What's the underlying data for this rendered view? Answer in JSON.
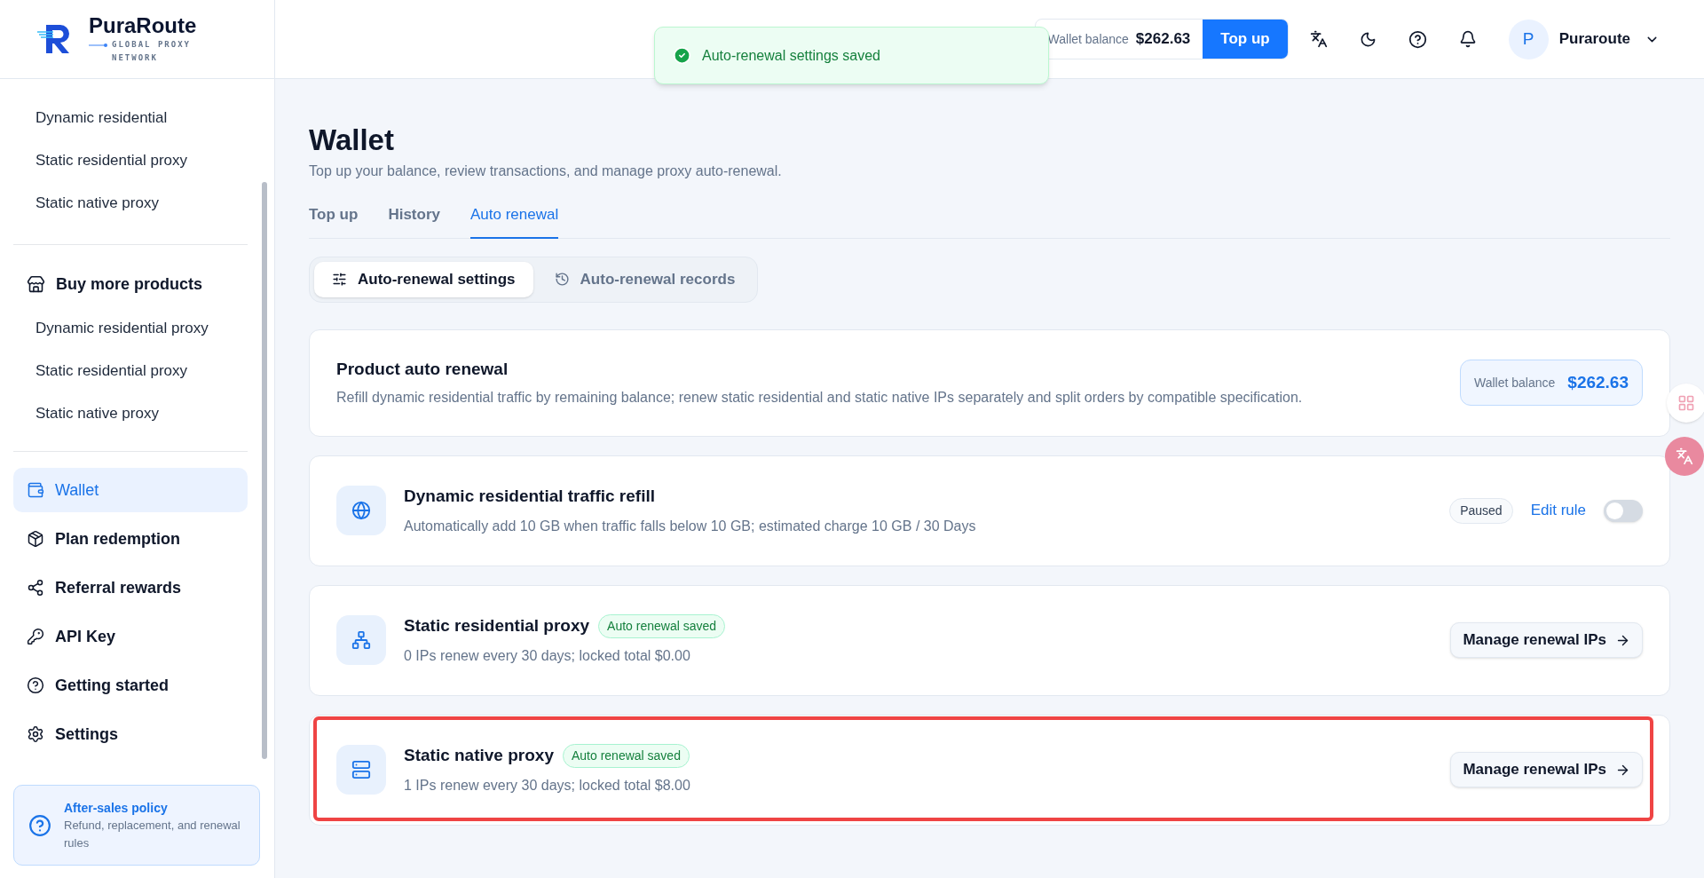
{
  "brand": {
    "name": "PuraRoute",
    "tagline": "GLOBAL PROXY NETWORK"
  },
  "sidebar": {
    "my_products": [
      {
        "label": "Dynamic residential"
      },
      {
        "label": "Static residential proxy"
      },
      {
        "label": "Static native proxy"
      }
    ],
    "buy_more": {
      "title": "Buy more products",
      "items": [
        {
          "label": "Dynamic residential proxy"
        },
        {
          "label": "Static residential proxy"
        },
        {
          "label": "Static native proxy"
        }
      ]
    },
    "nav": [
      {
        "kind": "wallet",
        "label": "Wallet",
        "selected": true
      },
      {
        "kind": "redeem",
        "label": "Plan redemption",
        "selected": false
      },
      {
        "kind": "referral",
        "label": "Referral rewards",
        "selected": false
      },
      {
        "kind": "key",
        "label": "API Key",
        "selected": false
      },
      {
        "kind": "help",
        "label": "Getting started",
        "selected": false
      },
      {
        "kind": "settings",
        "label": "Settings",
        "selected": false
      }
    ],
    "policy": {
      "title": "After-sales policy",
      "text": "Refund, replacement, and renewal rules"
    }
  },
  "toast": {
    "text": "Auto-renewal settings saved"
  },
  "header": {
    "balance_label": "Wallet balance",
    "balance": "$262.63",
    "top_up": "Top up",
    "user_initial": "P",
    "user_name": "Puraroute"
  },
  "page": {
    "title": "Wallet",
    "subtitle": "Top up your balance, review transactions, and manage proxy auto-renewal.",
    "tabs": [
      {
        "label": "Top up",
        "selected": false
      },
      {
        "label": "History",
        "selected": false
      },
      {
        "label": "Auto renewal",
        "selected": true
      }
    ],
    "segments": [
      {
        "kind": "settings",
        "label": "Auto-renewal settings",
        "selected": true
      },
      {
        "kind": "records",
        "label": "Auto-renewal records",
        "selected": false
      }
    ],
    "summary": {
      "title": "Product auto renewal",
      "text": "Refill dynamic residential traffic by remaining balance; renew static residential and static native IPs separately and split orders by compatible specification.",
      "balance_label": "Wallet balance",
      "balance": "$262.63"
    },
    "products": [
      {
        "kind": "dynamic",
        "title": "Dynamic residential traffic refill",
        "text": "Automatically add 10 GB when traffic falls below 10 GB; estimated charge 10 GB / 30 Days",
        "status": "Paused",
        "link": "Edit rule",
        "on": false,
        "highlighted": false
      },
      {
        "kind": "static",
        "title": "Static residential proxy",
        "badge": "Auto renewal saved",
        "text": "0 IPs renew every 30 days; locked total $0.00",
        "button": "Manage renewal IPs",
        "highlighted": false
      },
      {
        "kind": "static",
        "title": "Static native proxy",
        "badge": "Auto renewal saved",
        "text": "1 IPs renew every 30 days; locked total $8.00",
        "button": "Manage renewal IPs",
        "highlighted": true
      }
    ]
  }
}
